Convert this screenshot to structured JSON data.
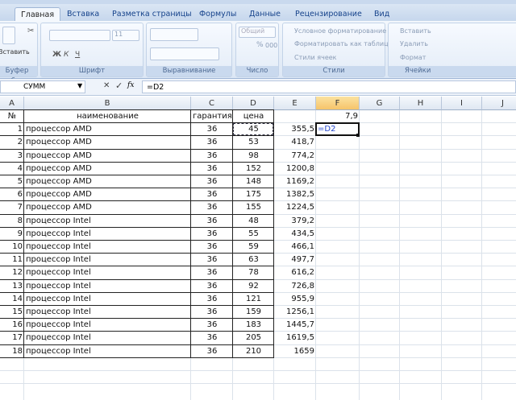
{
  "tabs": [
    "Главная",
    "Вставка",
    "Разметка страницы",
    "Формулы",
    "Данные",
    "Рецензирование",
    "Вид"
  ],
  "ribbon": {
    "clipboard": {
      "paste": "Вставить",
      "label": "Буфер обм..."
    },
    "font": {
      "size": "11",
      "bold": "Ж",
      "italic": "К",
      "underline": "Ч",
      "label": "Шрифт"
    },
    "alignment": {
      "label": "Выравнивание"
    },
    "number": {
      "format": "Общий",
      "percent": "%",
      "thousands": "000",
      "label": "Число"
    },
    "styles": {
      "conditional": "Условное форматирование",
      "as_table": "Форматировать как таблицу",
      "cell_styles": "Стили ячеек",
      "label": "Стили"
    },
    "cells": {
      "insert": "Вставить",
      "delete": "Удалить",
      "format": "Формат",
      "label": "Ячейки"
    }
  },
  "formula_bar": {
    "name_box": "СУММ",
    "cancel": "✕",
    "enter": "✓",
    "fx": "fx",
    "formula": "=D2"
  },
  "columns": [
    "A",
    "B",
    "C",
    "D",
    "E",
    "F",
    "G",
    "H",
    "I",
    "J"
  ],
  "selected_column": "F",
  "header_row": {
    "a": "№",
    "b": "наименование",
    "c": "гарантия",
    "d": "цена",
    "f": "7,9"
  },
  "rows": [
    {
      "a": "1",
      "b": "процессор AMD",
      "c": "36",
      "d": "45",
      "e": "355,5",
      "f": "=D2"
    },
    {
      "a": "2",
      "b": "процессор AMD",
      "c": "36",
      "d": "53",
      "e": "418,7"
    },
    {
      "a": "3",
      "b": "процессор AMD",
      "c": "36",
      "d": "98",
      "e": "774,2"
    },
    {
      "a": "4",
      "b": "процессор AMD",
      "c": "36",
      "d": "152",
      "e": "1200,8"
    },
    {
      "a": "5",
      "b": "процессор AMD",
      "c": "36",
      "d": "148",
      "e": "1169,2"
    },
    {
      "a": "6",
      "b": "процессор AMD",
      "c": "36",
      "d": "175",
      "e": "1382,5"
    },
    {
      "a": "7",
      "b": "процессор AMD",
      "c": "36",
      "d": "155",
      "e": "1224,5"
    },
    {
      "a": "8",
      "b": "процессор Intel",
      "c": "36",
      "d": "48",
      "e": "379,2"
    },
    {
      "a": "9",
      "b": "процессор Intel",
      "c": "36",
      "d": "55",
      "e": "434,5"
    },
    {
      "a": "10",
      "b": "процессор Intel",
      "c": "36",
      "d": "59",
      "e": "466,1"
    },
    {
      "a": "11",
      "b": "процессор Intel",
      "c": "36",
      "d": "63",
      "e": "497,7"
    },
    {
      "a": "12",
      "b": "процессор Intel",
      "c": "36",
      "d": "78",
      "e": "616,2"
    },
    {
      "a": "13",
      "b": "процессор Intel",
      "c": "36",
      "d": "92",
      "e": "726,8"
    },
    {
      "a": "14",
      "b": "процессор Intel",
      "c": "36",
      "d": "121",
      "e": "955,9"
    },
    {
      "a": "15",
      "b": "процессор Intel",
      "c": "36",
      "d": "159",
      "e": "1256,1"
    },
    {
      "a": "16",
      "b": "процессор Intel",
      "c": "36",
      "d": "183",
      "e": "1445,7"
    },
    {
      "a": "17",
      "b": "процессор Intel",
      "c": "36",
      "d": "205",
      "e": "1619,5"
    },
    {
      "a": "18",
      "b": "процессор Intel",
      "c": "36",
      "d": "210",
      "e": "1659"
    }
  ]
}
